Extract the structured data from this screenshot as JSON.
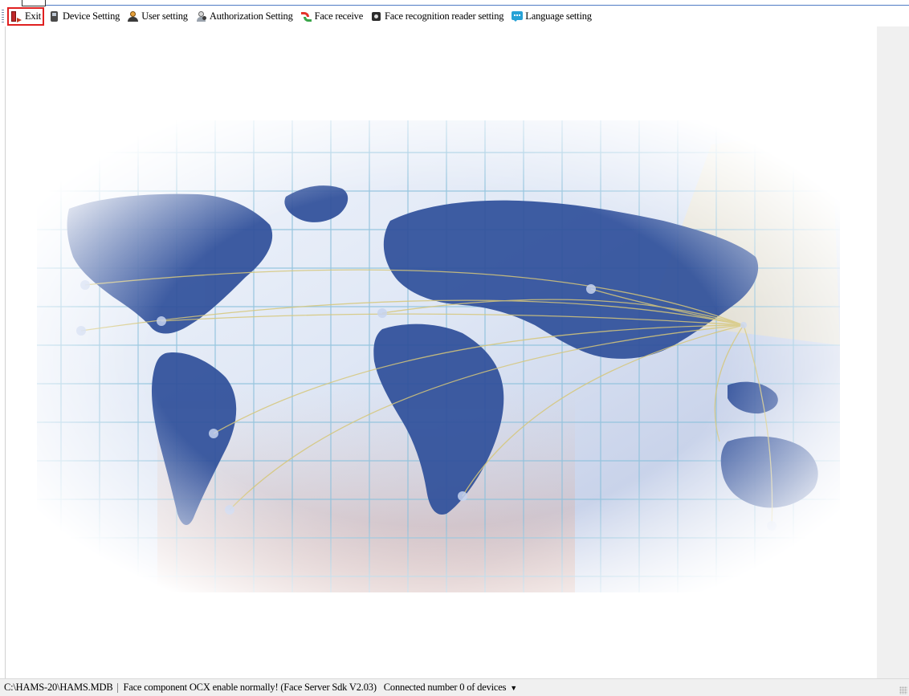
{
  "toolbar": {
    "items": [
      {
        "label": "Exit",
        "icon": "exit-icon"
      },
      {
        "label": "Device Setting",
        "icon": "device-icon"
      },
      {
        "label": "User setting",
        "icon": "user-icon"
      },
      {
        "label": "Authorization Setting",
        "icon": "authorization-icon"
      },
      {
        "label": "Face receive",
        "icon": "face-receive-icon"
      },
      {
        "label": "Face recognition reader setting",
        "icon": "reader-icon"
      },
      {
        "label": "Language setting",
        "icon": "language-icon"
      }
    ]
  },
  "main": {
    "background": "world-map-network-image"
  },
  "statusbar": {
    "db_path": "C:\\HAMS-20\\HAMS.MDB",
    "face_status": "Face component OCX enable normally! (Face Server Sdk V2.03)",
    "connected": "Connected number 0 of devices",
    "dropdown_icon": "chevron-down-icon"
  },
  "colors": {
    "map_blue": "#2f4f9a",
    "ocean_light": "#e7eefa",
    "grid_line": "#9ec7e0",
    "selection_border": "#e02020"
  }
}
